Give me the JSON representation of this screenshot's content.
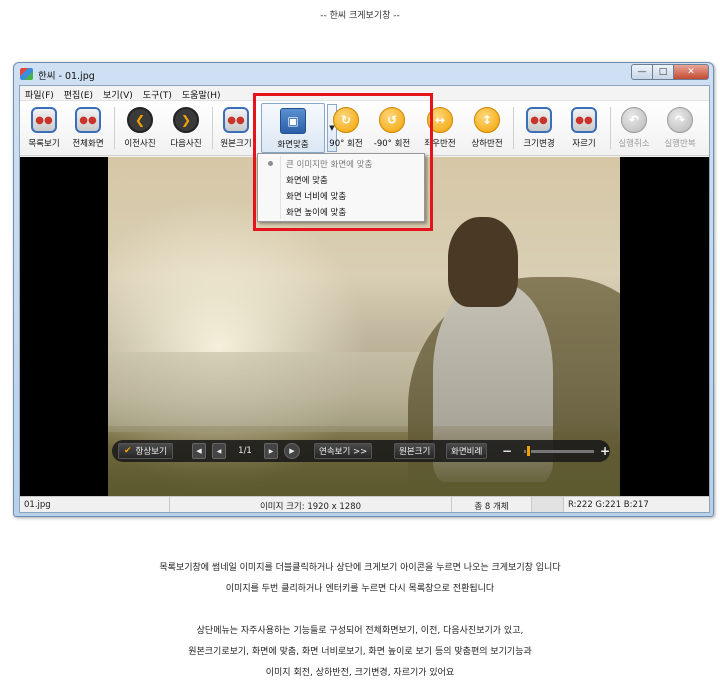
{
  "caption": "-- 한씨 크게보기창 --",
  "window": {
    "title": "한씨 - 01.jpg"
  },
  "menus": [
    "파일(F)",
    "편집(E)",
    "보기(V)",
    "도구(T)",
    "도움말(H)"
  ],
  "toolbar": {
    "list_view": "목록보기",
    "fullscreen": "전체화면",
    "prev_photo": "이전사진",
    "next_photo": "다음사진",
    "original_size": "원본크기",
    "fit_screen": "화면맞춤",
    "rotate_90": "90° 회전",
    "rotate_minus_90": "-90° 회전",
    "flip_horizontal": "좌우반전",
    "flip_vertical": "상하반전",
    "resize": "크기변경",
    "crop": "자르기",
    "undo": "실행취소",
    "redo": "실행반복"
  },
  "fit_menu": {
    "items": [
      {
        "label": "큰 이미지만 화면에 맞춤",
        "checked": true
      },
      {
        "label": "화면에 맞춤",
        "checked": false
      },
      {
        "label": "화면 너비에 맞춤",
        "checked": false
      },
      {
        "label": "화면 높이에 맞춤",
        "checked": false
      }
    ]
  },
  "controls": {
    "always_view": "항상보기",
    "page": "1/1",
    "slideshow": "연속보기 >>",
    "original": "원본크기",
    "ratio": "화면비례",
    "zoom_fraction": 0.05
  },
  "status": {
    "file": "01.jpg",
    "image_size": "이미지 크기: 1920 x 1280",
    "count": "총 8 개체",
    "rgb": "R:222 G:221 B:217"
  },
  "description": {
    "line1": "목록보기창에 썸네일 이미지를 더블클릭하거나 상단에 크게보기 아이콘을 누르면 나오는 크게보기창 입니다",
    "line2": "이미지를 두번 클리하거나 엔터키를 누르면 다시 목록창으로 전환됩니다",
    "line3": "상단메뉴는 자주사용하는 기능들로 구성되어 전체화면보기, 이전, 다음사진보기가 있고,",
    "line4": "원본크기로보기, 화면에 맞춤, 화면 너비로보기, 화면 높이로 보기 등의 맞춤편의 보기기능과",
    "line5": "이미지 회전, 상하반전, 크기변경, 자르기가 있어요"
  },
  "colors": {
    "highlight": "#e5131b",
    "accent": "#f2a200",
    "toolbar_blue": "#3a6fb8"
  }
}
